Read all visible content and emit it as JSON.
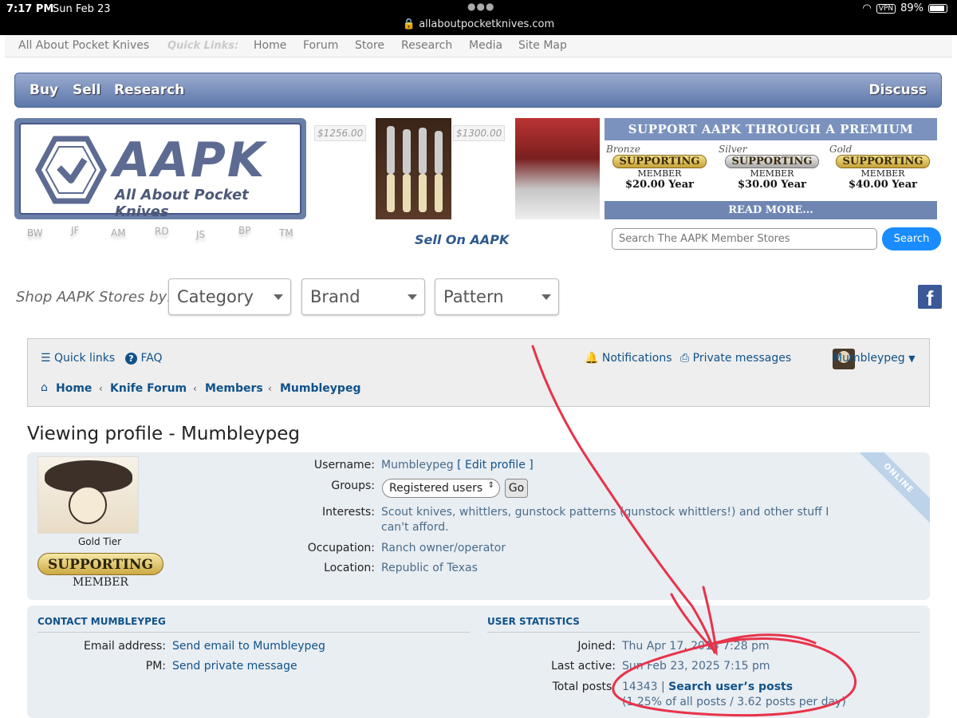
{
  "status": {
    "time": "7:17 PM",
    "date": "Sun Feb 23",
    "url": "allaboutpocketknives.com",
    "vpn": "VPN",
    "battery": "89%"
  },
  "topnav": {
    "site": "All About Pocket Knives",
    "quick_links_label": "Quick Links:",
    "links": [
      "Home",
      "Forum",
      "Store",
      "Research",
      "Media",
      "Site Map"
    ]
  },
  "mainbar": {
    "buy": "Buy",
    "sell": "Sell",
    "research": "Research",
    "discuss": "Discuss"
  },
  "logo": {
    "title": "AAPK",
    "subtitle": "All About Pocket Knives"
  },
  "initials": [
    "BW",
    "JF",
    "AM",
    "RD",
    "JS",
    "BP",
    "TM"
  ],
  "listings": [
    {
      "price": "$1256.00"
    },
    {
      "price": "$1300.00"
    }
  ],
  "promo": {
    "header": "SUPPORT AAPK THROUGH A PREMIUM SUBSCRIPTION",
    "tiers": [
      {
        "name": "Bronze",
        "ribbon": "SUPPORTING",
        "member": "MEMBER",
        "price": "$20.00 Year"
      },
      {
        "name": "Silver",
        "ribbon": "SUPPORTING",
        "member": "MEMBER",
        "price": "$30.00 Year"
      },
      {
        "name": "Gold",
        "ribbon": "SUPPORTING",
        "member": "MEMBER",
        "price": "$40.00 Year"
      }
    ],
    "read_more": "READ MORE..."
  },
  "sell_on": "Sell On AAPK",
  "store_search": {
    "placeholder": "Search The AAPK Member Stores",
    "button": "Search"
  },
  "shop_by": {
    "label": "Shop AAPK Stores by:",
    "selects": [
      "Category",
      "Brand",
      "Pattern"
    ]
  },
  "facebook": "f",
  "forum_nav": {
    "quick_links": "Quick links",
    "faq": "FAQ",
    "notifications": "Notifications",
    "private_messages": "Private messages",
    "user": "Mumbleypeg",
    "breadcrumbs": [
      "Home",
      "Knife Forum",
      "Members",
      "Mumbleypeg"
    ]
  },
  "profile": {
    "title": "Viewing profile - Mumbleypeg",
    "tier_label": "Gold Tier",
    "badge_ribbon": "SUPPORTING",
    "badge_member": "MEMBER",
    "online": "ONLINE",
    "username_label": "Username:",
    "username": "Mumbleypeg",
    "edit_profile": "Edit profile",
    "groups_label": "Groups:",
    "groups_value": "Registered users",
    "go": "Go",
    "interests_label": "Interests:",
    "interests_line1": "Scout knives, whittlers, gunstock patterns (gunstock whittlers!) and other stuff I",
    "interests_line2": "can't afford.",
    "occupation_label": "Occupation:",
    "occupation": "Ranch owner/operator",
    "location_label": "Location:",
    "location": "Republic of Texas"
  },
  "contact": {
    "heading": "CONTACT MUMBLEYPEG",
    "email_label": "Email address:",
    "email_link": "Send email to Mumbleypeg",
    "pm_label": "PM:",
    "pm_link": "Send private message"
  },
  "user_stats": {
    "heading": "USER STATISTICS",
    "joined_label": "Joined:",
    "joined": "Thu Apr 17, 2014 7:28 pm",
    "last_active_label": "Last active:",
    "last_active": "Sun Feb 23, 2025 7:15 pm",
    "total_posts_label": "Total posts:",
    "total_posts": "14343",
    "search_posts": "Search user’s posts",
    "posts_detail": "(1.25% of all posts / 3.62 posts per day)"
  },
  "colors": {
    "link": "#105289",
    "annotation": "#e8334a",
    "bar": "#5d77aa",
    "search_button": "#1a8cff"
  }
}
